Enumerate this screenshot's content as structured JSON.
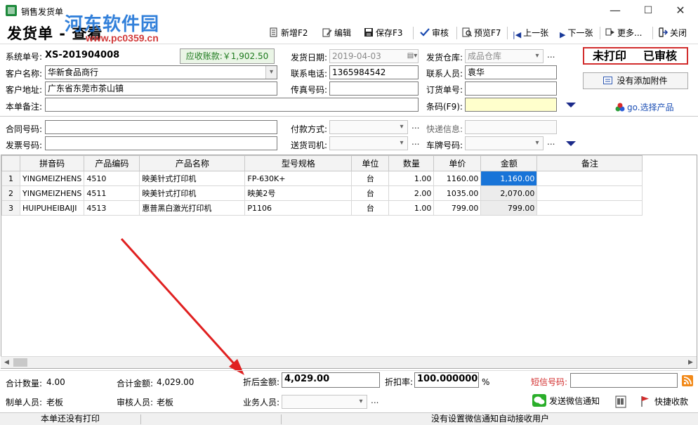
{
  "window": {
    "title": "销售发货单",
    "watermark": "河东软件园",
    "watermark_url": "www.pc0359.cn",
    "minimize": "—",
    "maximize": "☐",
    "close": "✕"
  },
  "form_title": "发货单 - 查看",
  "toolbar": {
    "new_label": "新增F2",
    "edit_label": "编辑",
    "save_label": "保存F3",
    "audit_label": "审核",
    "preview_label": "预览F7",
    "prev_label": "上一张",
    "next_label": "下一张",
    "more_label": "更多...",
    "close_label": "关闭"
  },
  "header": {
    "system_no_label": "系统单号:",
    "system_no": "XS-201904008",
    "receivable_label": "应收账款:",
    "receivable_value": "￥1,902.50",
    "ship_date_label": "发货日期:",
    "ship_date": "2019-04-03",
    "warehouse_label": "发货仓库:",
    "warehouse": "成品仓库",
    "status_unprinted": "未打印",
    "status_audited": "已审核",
    "customer_label": "客户名称:",
    "customer": "华新食品商行",
    "phone_label": "联系电话:",
    "phone": "1365984542",
    "contact_label": "联系人员:",
    "contact": "袁华",
    "attach_label": "没有添加附件",
    "address_label": "客户地址:",
    "address": "广东省东莞市茶山镇",
    "fax_label": "传真号码:",
    "fax": "",
    "order_no_label": "订货单号:",
    "order_no": "",
    "remark_label": "本单备注:",
    "remark": "",
    "barcode_label": "条码(F9):",
    "barcode": "",
    "go_select_label": "go.选择产品",
    "contract_label": "合同号码:",
    "contract": "",
    "payment_label": "付款方式:",
    "payment": "",
    "express_label": "快递信息:",
    "express": "",
    "invoice_label": "发票号码:",
    "invoice": "",
    "driver_label": "送货司机:",
    "driver": "",
    "plate_label": "车牌号码:",
    "plate": "",
    "ellipsis": "..."
  },
  "grid": {
    "columns": [
      "",
      "拼音码",
      "产品编码",
      "产品名称",
      "型号规格",
      "单位",
      "数量",
      "单价",
      "金额",
      "备注"
    ],
    "rows": [
      {
        "no": "1",
        "pinyin": "YINGMEIZHENS",
        "code": "4510",
        "name": "映美针式打印机",
        "model": "FP-630K+",
        "unit": "台",
        "qty": "1.00",
        "price": "1160.00",
        "amount": "1,160.00",
        "note": ""
      },
      {
        "no": "2",
        "pinyin": "YINGMEIZHENS",
        "code": "4511",
        "name": "映美针式打印机",
        "model": "映美2号",
        "unit": "台",
        "qty": "2.00",
        "price": "1035.00",
        "amount": "2,070.00",
        "note": ""
      },
      {
        "no": "3",
        "pinyin": "HUIPUHEIBAIJI",
        "code": "4513",
        "name": "惠普黑白激光打印机",
        "model": "P1106",
        "unit": "台",
        "qty": "1.00",
        "price": "799.00",
        "amount": "799.00",
        "note": ""
      }
    ]
  },
  "footer": {
    "total_qty_label": "合计数量:",
    "total_qty": "4.00",
    "total_amount_label": "合计金额:",
    "total_amount": "4,029.00",
    "discounted_label": "折后金额:",
    "discounted": "4,029.00",
    "discount_rate_label": "折扣率:",
    "discount_rate": "100.000000",
    "percent": "%",
    "sms_label": "短信号码:",
    "sms": "",
    "creator_label": "制单人员:",
    "creator": "老板",
    "auditor_label": "审核人员:",
    "auditor": "老板",
    "sales_label": "业务人员:",
    "sales": "",
    "wechat_label": "发送微信通知",
    "quick_receive_label": "快捷收款"
  },
  "statusbar": {
    "left": "本单还没有打印",
    "right": "没有设置微信通知自动接收用户"
  },
  "colors": {
    "status_border": "#d22d2d",
    "selected_cell": "#1874d8",
    "receivable_text": "#1d7a1d",
    "barcode_bg": "#ffffcc",
    "annotation_arrow": "#e02020",
    "watermark": "#1c73d6"
  }
}
